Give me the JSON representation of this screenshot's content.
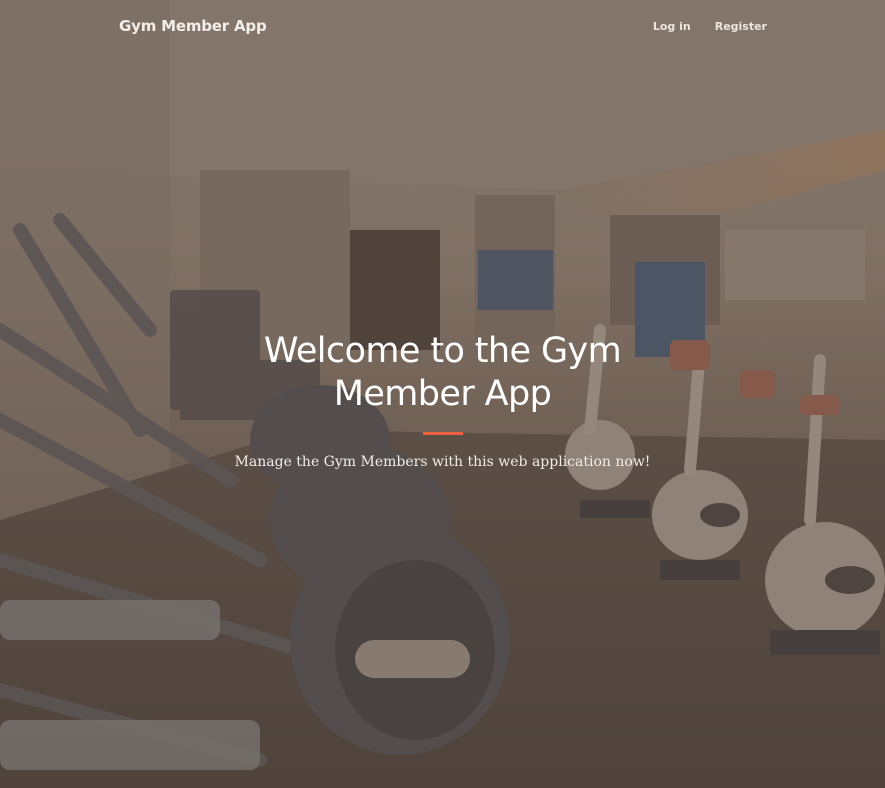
{
  "navbar": {
    "brand": "Gym Member App",
    "links": [
      {
        "label": "Log in"
      },
      {
        "label": "Register"
      }
    ]
  },
  "hero": {
    "title": "Welcome to the Gym Member App",
    "subtitle": "Manage the Gym Members with this web application now!"
  },
  "colors": {
    "accent": "#f05f40",
    "overlay": "#5c4d42",
    "text": "#ffffff"
  },
  "background_image": "gym-interior-photo"
}
